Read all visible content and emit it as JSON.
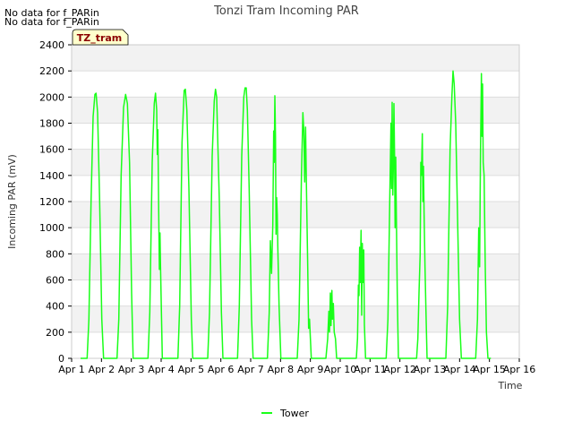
{
  "notes": [
    "No data for f_PARin",
    "No data for f_PARin"
  ],
  "site_badge": "TZ_tram",
  "colors": {
    "series": "#19ff19",
    "badge_bg": "#ffffcc",
    "badge_text": "#8b0000",
    "band": "#f2f2f2"
  },
  "chart_data": {
    "type": "line",
    "title": "Tonzi Tram Incoming PAR",
    "xlabel": "Time",
    "ylabel": "Incoming PAR (mV)",
    "xticks": [
      "Apr 1",
      "Apr 2",
      "Apr 3",
      "Apr 4",
      "Apr 5",
      "Apr 6",
      "Apr 7",
      "Apr 8",
      "Apr 9",
      "Apr 10",
      "Apr 11",
      "Apr 12",
      "Apr 13",
      "Apr 14",
      "Apr 15",
      "Apr 16"
    ],
    "xlim": [
      1,
      16
    ],
    "ylim": [
      0,
      2400
    ],
    "yticks": [
      0,
      200,
      400,
      600,
      800,
      1000,
      1200,
      1400,
      1600,
      1800,
      2000,
      2200,
      2400
    ],
    "grid": true,
    "legend_position": "bottom",
    "series": [
      {
        "name": "Tower",
        "x_unit": "day of April",
        "points": [
          [
            1.3,
            0
          ],
          [
            1.52,
            0
          ],
          [
            1.58,
            300
          ],
          [
            1.65,
            1200
          ],
          [
            1.72,
            1850
          ],
          [
            1.78,
            2020
          ],
          [
            1.82,
            2030
          ],
          [
            1.87,
            1880
          ],
          [
            1.94,
            1200
          ],
          [
            2.01,
            300
          ],
          [
            2.07,
            0
          ],
          [
            2.52,
            0
          ],
          [
            2.58,
            300
          ],
          [
            2.66,
            1400
          ],
          [
            2.74,
            1920
          ],
          [
            2.81,
            2020
          ],
          [
            2.87,
            1950
          ],
          [
            2.94,
            1500
          ],
          [
            3.01,
            500
          ],
          [
            3.06,
            0
          ],
          [
            3.56,
            0
          ],
          [
            3.62,
            350
          ],
          [
            3.7,
            1500
          ],
          [
            3.77,
            1950
          ],
          [
            3.81,
            2030
          ],
          [
            3.85,
            1900
          ],
          [
            3.87,
            1560
          ],
          [
            3.89,
            1750
          ],
          [
            3.92,
            1100
          ],
          [
            3.94,
            680
          ],
          [
            3.96,
            960
          ],
          [
            3.98,
            700
          ],
          [
            4.04,
            0
          ],
          [
            4.56,
            0
          ],
          [
            4.62,
            400
          ],
          [
            4.7,
            1650
          ],
          [
            4.77,
            2050
          ],
          [
            4.81,
            2060
          ],
          [
            4.86,
            1900
          ],
          [
            4.93,
            1300
          ],
          [
            5.01,
            300
          ],
          [
            5.06,
            0
          ],
          [
            5.56,
            0
          ],
          [
            5.62,
            350
          ],
          [
            5.71,
            1550
          ],
          [
            5.78,
            1970
          ],
          [
            5.82,
            2060
          ],
          [
            5.86,
            2000
          ],
          [
            5.88,
            1800
          ],
          [
            5.95,
            1200
          ],
          [
            6.02,
            350
          ],
          [
            6.07,
            0
          ],
          [
            6.56,
            0
          ],
          [
            6.62,
            400
          ],
          [
            6.7,
            1550
          ],
          [
            6.77,
            2000
          ],
          [
            6.81,
            2070
          ],
          [
            6.85,
            2070
          ],
          [
            6.89,
            1900
          ],
          [
            6.95,
            1300
          ],
          [
            7.03,
            300
          ],
          [
            7.08,
            0
          ],
          [
            7.56,
            0
          ],
          [
            7.62,
            350
          ],
          [
            7.66,
            900
          ],
          [
            7.7,
            650
          ],
          [
            7.74,
            1020
          ],
          [
            7.77,
            1740
          ],
          [
            7.79,
            1500
          ],
          [
            7.81,
            2010
          ],
          [
            7.83,
            1700
          ],
          [
            7.85,
            950
          ],
          [
            7.87,
            1230
          ],
          [
            7.89,
            1100
          ],
          [
            7.91,
            850
          ],
          [
            7.95,
            400
          ],
          [
            8.01,
            0
          ],
          [
            8.56,
            0
          ],
          [
            8.62,
            300
          ],
          [
            8.7,
            1400
          ],
          [
            8.75,
            1880
          ],
          [
            8.78,
            1750
          ],
          [
            8.81,
            1350
          ],
          [
            8.84,
            1770
          ],
          [
            8.87,
            1300
          ],
          [
            8.91,
            700
          ],
          [
            8.94,
            230
          ],
          [
            8.97,
            300
          ],
          [
            9.03,
            0
          ],
          [
            9.52,
            0
          ],
          [
            9.58,
            150
          ],
          [
            9.62,
            360
          ],
          [
            9.64,
            200
          ],
          [
            9.67,
            500
          ],
          [
            9.69,
            250
          ],
          [
            9.72,
            520
          ],
          [
            9.74,
            300
          ],
          [
            9.77,
            420
          ],
          [
            9.8,
            200
          ],
          [
            9.84,
            150
          ],
          [
            9.88,
            0
          ],
          [
            10.54,
            0
          ],
          [
            10.58,
            150
          ],
          [
            10.61,
            560
          ],
          [
            10.63,
            480
          ],
          [
            10.65,
            850
          ],
          [
            10.67,
            580
          ],
          [
            10.7,
            980
          ],
          [
            10.72,
            330
          ],
          [
            10.74,
            880
          ],
          [
            10.76,
            580
          ],
          [
            10.79,
            830
          ],
          [
            10.81,
            260
          ],
          [
            10.85,
            0
          ],
          [
            11.54,
            0
          ],
          [
            11.6,
            300
          ],
          [
            11.66,
            1200
          ],
          [
            11.7,
            1800
          ],
          [
            11.72,
            1300
          ],
          [
            11.74,
            1960
          ],
          [
            11.76,
            1250
          ],
          [
            11.78,
            1450
          ],
          [
            11.8,
            1950
          ],
          [
            11.82,
            1550
          ],
          [
            11.84,
            1000
          ],
          [
            11.86,
            1540
          ],
          [
            11.88,
            1100
          ],
          [
            11.91,
            500
          ],
          [
            11.95,
            0
          ],
          [
            12.56,
            0
          ],
          [
            12.6,
            150
          ],
          [
            12.64,
            500
          ],
          [
            12.68,
            800
          ],
          [
            12.7,
            1500
          ],
          [
            12.72,
            1400
          ],
          [
            12.75,
            1720
          ],
          [
            12.77,
            1200
          ],
          [
            12.79,
            1470
          ],
          [
            12.81,
            1100
          ],
          [
            12.84,
            700
          ],
          [
            12.87,
            380
          ],
          [
            12.91,
            0
          ],
          [
            13.54,
            0
          ],
          [
            13.6,
            400
          ],
          [
            13.68,
            1600
          ],
          [
            13.74,
            2000
          ],
          [
            13.78,
            2200
          ],
          [
            13.82,
            2100
          ],
          [
            13.87,
            1800
          ],
          [
            13.93,
            1100
          ],
          [
            14.0,
            300
          ],
          [
            14.06,
            0
          ],
          [
            14.54,
            0
          ],
          [
            14.6,
            300
          ],
          [
            14.64,
            1000
          ],
          [
            14.67,
            700
          ],
          [
            14.7,
            1600
          ],
          [
            14.73,
            2180
          ],
          [
            14.75,
            1700
          ],
          [
            14.77,
            2100
          ],
          [
            14.79,
            1500
          ],
          [
            14.82,
            1400
          ],
          [
            14.86,
            700
          ],
          [
            14.9,
            200
          ],
          [
            14.95,
            0
          ],
          [
            15.05,
            0
          ]
        ]
      }
    ]
  }
}
